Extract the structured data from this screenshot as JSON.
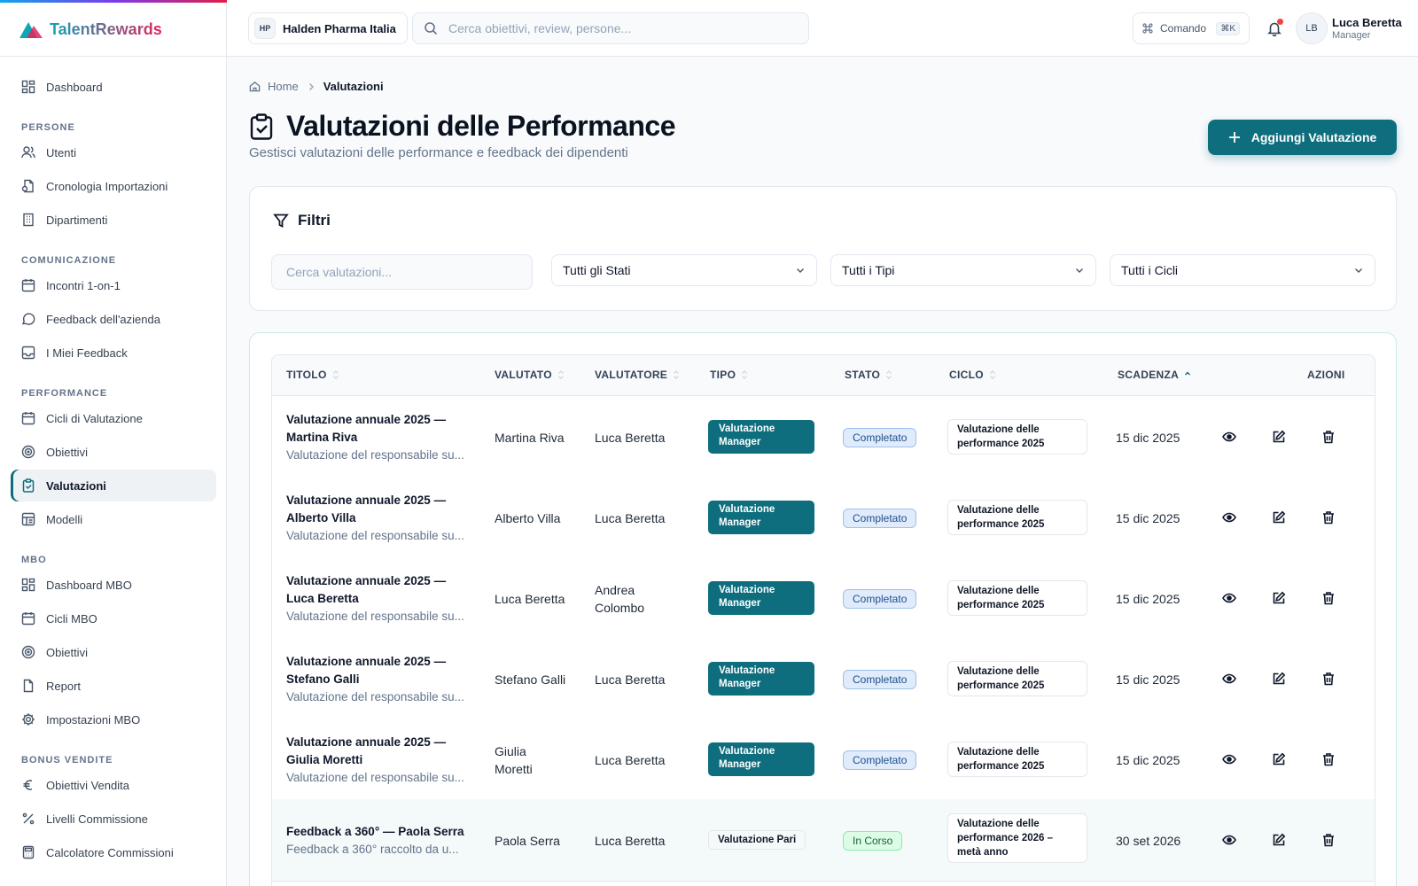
{
  "app": {
    "name": "TalentRewards"
  },
  "sidebar": {
    "dashboard": "Dashboard",
    "sections": {
      "persone": "PERSONE",
      "comunicazione": "COMUNICAZIONE",
      "performance": "PERFORMANCE",
      "mbo": "MBO",
      "bonus": "BONUS VENDITE"
    },
    "persone": [
      "Utenti",
      "Cronologia Importazioni",
      "Dipartimenti"
    ],
    "comunicazione": [
      "Incontri 1-on-1",
      "Feedback dell'azienda",
      "I Miei Feedback"
    ],
    "performance": [
      "Cicli di Valutazione",
      "Obiettivi",
      "Valutazioni",
      "Modelli"
    ],
    "mbo": [
      "Dashboard MBO",
      "Cicli MBO",
      "Obiettivi",
      "Report",
      "Impostazioni MBO"
    ],
    "bonus": [
      "Obiettivi Vendita",
      "Livelli Commissione",
      "Calcolatore Commissioni"
    ]
  },
  "topbar": {
    "company_initials": "HP",
    "company_name": "Halden Pharma Italia",
    "search_placeholder": "Cerca obiettivi, review, persone...",
    "command_label": "Comando",
    "command_kbd": "⌘K",
    "user_initials": "LB",
    "user_name": "Luca Beretta",
    "user_role": "Manager"
  },
  "breadcrumb": {
    "home": "Home",
    "current": "Valutazioni"
  },
  "page": {
    "title": "Valutazioni delle Performance",
    "subtitle": "Gestisci valutazioni delle performance e feedback dei dipendenti",
    "add_button": "Aggiungi Valutazione"
  },
  "filters": {
    "title": "Filtri",
    "search_placeholder": "Cerca valutazioni...",
    "stato": "Tutti gli Stati",
    "tipo": "Tutti i Tipi",
    "ciclo": "Tutti i Cicli"
  },
  "table": {
    "headers": {
      "titolo": "TITOLO",
      "valutato": "VALUTATO",
      "valutatore": "VALUTATORE",
      "tipo": "TIPO",
      "stato": "STATO",
      "ciclo": "CICLO",
      "scadenza": "SCADENZA",
      "azioni": "AZIONI"
    },
    "rows": [
      {
        "title_1": "Valutazione annuale 2025 —",
        "title_2": "Martina Riva",
        "desc": "Valutazione del responsabile su...",
        "valutato_1": "Martina Riva",
        "valutato_2": "",
        "valutatore_1": "Luca Beretta",
        "valutatore_2": "",
        "tipo_1": "Valutazione",
        "tipo_2": "Manager",
        "stato": "Completato",
        "ciclo_1": "Valutazione delle",
        "ciclo_2": "performance 2025",
        "ciclo_3": "",
        "scadenza": "15 dic 2025"
      },
      {
        "title_1": "Valutazione annuale 2025 —",
        "title_2": "Alberto Villa",
        "desc": "Valutazione del responsabile su...",
        "valutato_1": "Alberto Villa",
        "valutato_2": "",
        "valutatore_1": "Luca Beretta",
        "valutatore_2": "",
        "tipo_1": "Valutazione",
        "tipo_2": "Manager",
        "stato": "Completato",
        "ciclo_1": "Valutazione delle",
        "ciclo_2": "performance 2025",
        "ciclo_3": "",
        "scadenza": "15 dic 2025"
      },
      {
        "title_1": "Valutazione annuale 2025 —",
        "title_2": "Luca Beretta",
        "desc": "Valutazione del responsabile su...",
        "valutato_1": "Luca Beretta",
        "valutato_2": "",
        "valutatore_1": "Andrea",
        "valutatore_2": "Colombo",
        "tipo_1": "Valutazione",
        "tipo_2": "Manager",
        "stato": "Completato",
        "ciclo_1": "Valutazione delle",
        "ciclo_2": "performance 2025",
        "ciclo_3": "",
        "scadenza": "15 dic 2025"
      },
      {
        "title_1": "Valutazione annuale 2025 —",
        "title_2": "Stefano Galli",
        "desc": "Valutazione del responsabile su...",
        "valutato_1": "Stefano Galli",
        "valutato_2": "",
        "valutatore_1": "Luca Beretta",
        "valutatore_2": "",
        "tipo_1": "Valutazione",
        "tipo_2": "Manager",
        "stato": "Completato",
        "ciclo_1": "Valutazione delle",
        "ciclo_2": "performance 2025",
        "ciclo_3": "",
        "scadenza": "15 dic 2025"
      },
      {
        "title_1": "Valutazione annuale 2025 —",
        "title_2": "Giulia Moretti",
        "desc": "Valutazione del responsabile su...",
        "valutato_1": "Giulia",
        "valutato_2": "Moretti",
        "valutatore_1": "Luca Beretta",
        "valutatore_2": "",
        "tipo_1": "Valutazione",
        "tipo_2": "Manager",
        "stato": "Completato",
        "ciclo_1": "Valutazione delle",
        "ciclo_2": "performance 2025",
        "ciclo_3": "",
        "scadenza": "15 dic 2025"
      },
      {
        "title_1": "Feedback a 360° — Paola Serra",
        "title_2": "",
        "desc": "Feedback a 360° raccolto da u...",
        "valutato_1": "Paola Serra",
        "valutato_2": "",
        "valutatore_1": "Luca Beretta",
        "valutatore_2": "",
        "tipo_1": "Valutazione Pari",
        "tipo_2": "",
        "stato": "In Corso",
        "ciclo_1": "Valutazione delle",
        "ciclo_2": "performance 2026 –",
        "ciclo_3": "metà anno",
        "scadenza": "30 set 2026"
      }
    ]
  },
  "colors": {
    "accent": "#0e6e7e",
    "completed_bg": "#e0ecfb",
    "in_progress_bg": "#dcfce7",
    "notification": "#ef4444"
  }
}
